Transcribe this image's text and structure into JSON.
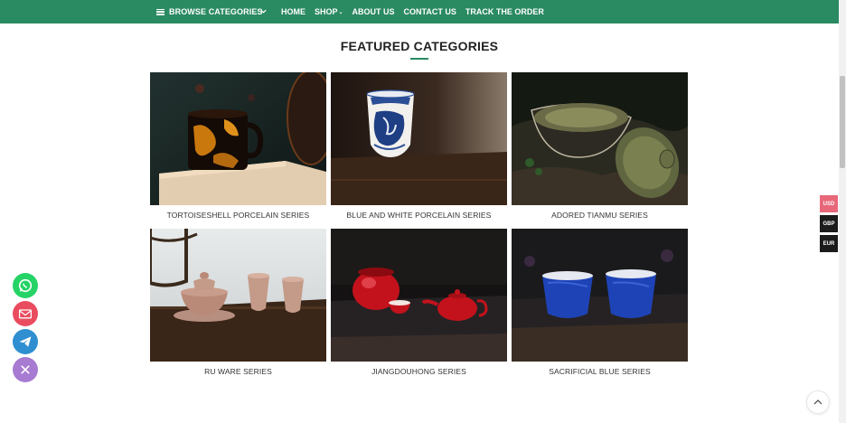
{
  "nav": {
    "browse_label": "BROWSE CATEGORIES",
    "items": [
      {
        "label": "HOME",
        "has_caret": false
      },
      {
        "label": "SHOP",
        "has_caret": true
      },
      {
        "label": "ABOUT US",
        "has_caret": false
      },
      {
        "label": "CONTACT US",
        "has_caret": false
      },
      {
        "label": "TRACK THE ORDER",
        "has_caret": false
      }
    ],
    "caret_glyph": "⌄"
  },
  "section": {
    "title": "FEATURED CATEGORIES"
  },
  "categories": [
    {
      "label": "TORTOISESHELL PORCELAIN SERIES"
    },
    {
      "label": "BLUE AND WHITE PORCELAIN SERIES"
    },
    {
      "label": "ADORED TIANMU SERIES"
    },
    {
      "label": "RU WARE SERIES"
    },
    {
      "label": "JIANGDOUHONG SERIES"
    },
    {
      "label": "SACRIFICIAL BLUE SERIES"
    }
  ],
  "currency": [
    {
      "code": "USD",
      "active": true
    },
    {
      "code": "GBP",
      "active": false
    },
    {
      "code": "EUR",
      "active": false
    }
  ],
  "floating_buttons": [
    {
      "icon": "whatsapp-icon",
      "color": "#25d366"
    },
    {
      "icon": "email-icon",
      "color": "#ea4c5f"
    },
    {
      "icon": "telegram-icon",
      "color": "#2f8fd0"
    },
    {
      "icon": "close-icon",
      "color": "#a77bd2"
    }
  ],
  "colors": {
    "brand_green": "#2a8a62",
    "currency_active": "#e8687a",
    "currency_inactive": "#1c1c1c"
  }
}
